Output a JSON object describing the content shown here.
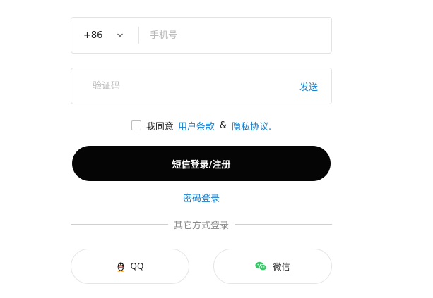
{
  "phone": {
    "country_code": "+86",
    "placeholder": "手机号",
    "value": ""
  },
  "code": {
    "placeholder": "验证码",
    "value": "",
    "send_label": "发送"
  },
  "agreement": {
    "prefix": "我同意",
    "terms_label": "用户条款",
    "connector": "&",
    "privacy_label": "隐私协议.",
    "checked": false
  },
  "submit_label": "短信登录/注册",
  "password_login_label": "密码登录",
  "divider_label": "其它方式登录",
  "social": {
    "qq_label": "QQ",
    "wechat_label": "微信"
  },
  "colors": {
    "link": "#1a7fc9",
    "primary_button": "#050505",
    "wechat_green": "#3fc36a"
  },
  "icons": {
    "country_dropdown": "chevron-down-icon",
    "qq": "qq-penguin-icon",
    "wechat": "wechat-icon"
  }
}
